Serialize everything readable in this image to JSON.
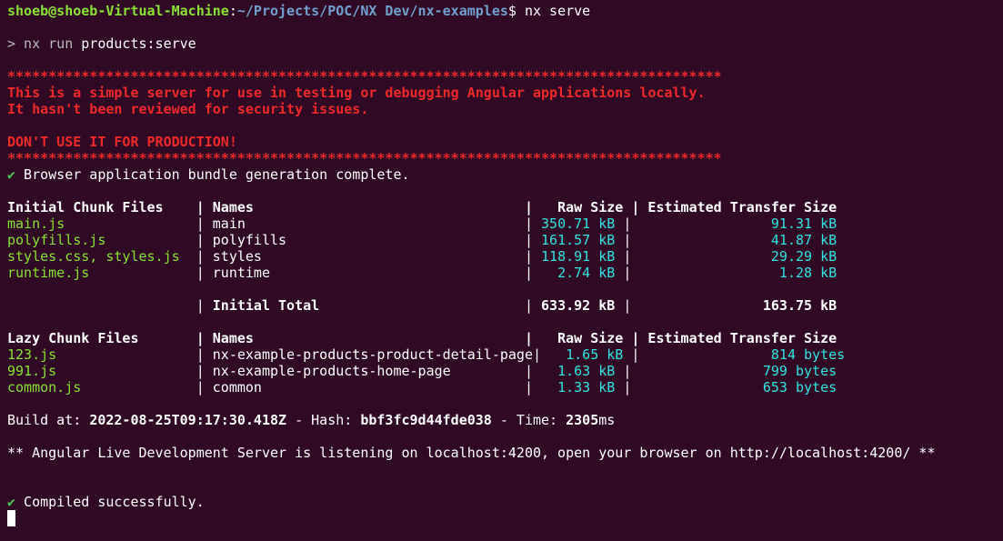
{
  "prompt": {
    "user_host": "shoeb@shoeb-Virtual-Machine",
    "colon": ":",
    "path": "~/Projects/POC/NX Dev/nx-examples",
    "dollar": "$",
    "command": " nx serve"
  },
  "run_line": {
    "prefix": "> nx run ",
    "target": "products:serve"
  },
  "warning": {
    "stars": "***************************************************************************************",
    "line1": "This is a simple server for use in testing or debugging Angular applications locally.",
    "line2": "It hasn't been reviewed for security issues.",
    "line3": "DON'T USE IT FOR PRODUCTION!"
  },
  "bundle_complete": {
    "check": "✔",
    "text": " Browser application bundle generation complete."
  },
  "initial_table": {
    "header": {
      "files": "Initial Chunk Files   ",
      "names": "Names                                 ",
      "raw": "  Raw Size",
      "est": "Estimated Transfer Size"
    },
    "rows": [
      {
        "file": "main.js               ",
        "name": "main                                  ",
        "raw": "350.71 kB",
        "est": "                91.31 kB"
      },
      {
        "file": "polyfills.js          ",
        "name": "polyfills                             ",
        "raw": "161.57 kB",
        "est": "                41.87 kB"
      },
      {
        "file": "styles.css, styles.js ",
        "name": "styles                                ",
        "raw": "118.91 kB",
        "est": "                29.29 kB"
      },
      {
        "file": "runtime.js            ",
        "name": "runtime                               ",
        "raw": "  2.74 kB",
        "est": "                 1.28 kB"
      }
    ],
    "total": {
      "label": "Initial Total",
      "raw": "633.92 kB",
      "est": "163.75 kB"
    }
  },
  "lazy_table": {
    "header": {
      "files": "Lazy Chunk Files      ",
      "names": "Names                                 ",
      "raw": "  Raw Size",
      "est": "Estimated Transfer Size"
    },
    "rows": [
      {
        "file": "123.js                ",
        "name": "nx-example-products-product-detail-page",
        "raw": "  1.65 kB",
        "est": "               814 bytes"
      },
      {
        "file": "991.js                ",
        "name": "nx-example-products-home-page         ",
        "raw": "  1.63 kB",
        "est": "               799 bytes"
      },
      {
        "file": "common.js             ",
        "name": "common                                ",
        "raw": "  1.33 kB",
        "est": "               653 bytes"
      }
    ]
  },
  "build": {
    "prefix": "Build at: ",
    "date": "2022-08-25T09:17:30.418Z",
    "hash_label": " - Hash: ",
    "hash": "bbf3fc9d44fde038",
    "time_label": " - Time: ",
    "time": "2305",
    "unit": "ms"
  },
  "server_msg": "** Angular Live Development Server is listening on localhost:4200, open your browser on http://localhost:4200/ **",
  "compiled": {
    "check": "✔",
    "text": " Compiled successfully."
  }
}
